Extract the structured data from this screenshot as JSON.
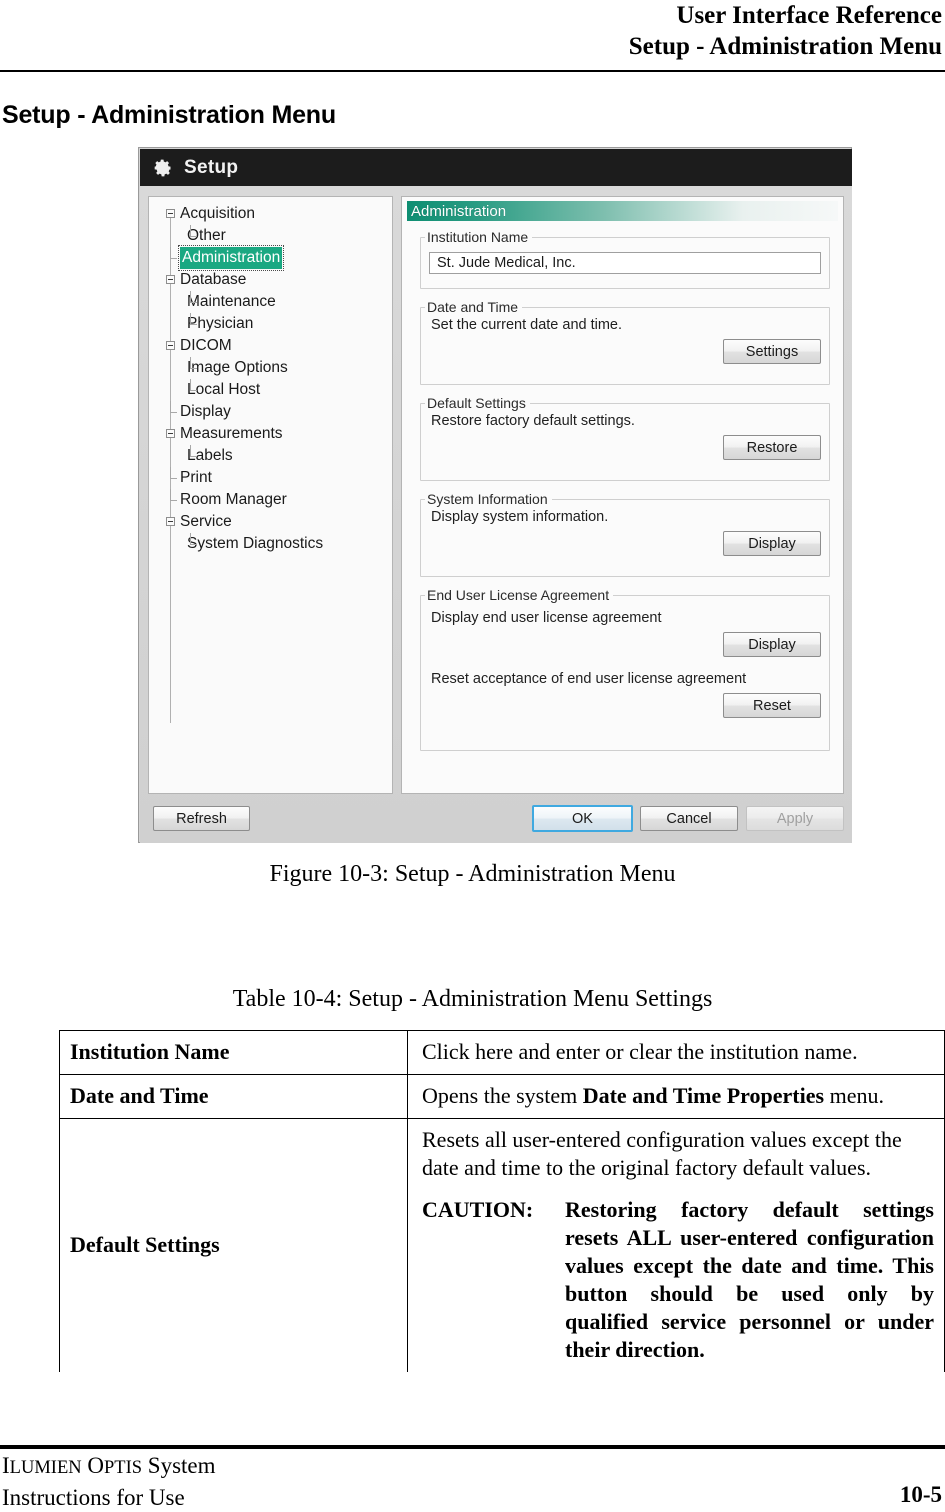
{
  "header": {
    "line1": "User Interface Reference",
    "line2": "Setup - Administration Menu"
  },
  "section_title": "Setup - Administration Menu",
  "figure": {
    "caption": "Figure 10-3:  Setup - Administration Menu",
    "dialog": {
      "title": "Setup",
      "icon": "gear-icon",
      "tree": {
        "items": [
          {
            "label": "Acquisition",
            "level": 0,
            "expander": true,
            "selected": false
          },
          {
            "label": "Other",
            "level": 1,
            "expander": false,
            "selected": false
          },
          {
            "label": "Administration",
            "level": 0,
            "expander": false,
            "selected": true
          },
          {
            "label": "Database",
            "level": 0,
            "expander": true,
            "selected": false
          },
          {
            "label": "Maintenance",
            "level": 1,
            "expander": false,
            "selected": false
          },
          {
            "label": "Physician",
            "level": 1,
            "expander": false,
            "selected": false
          },
          {
            "label": "DICOM",
            "level": 0,
            "expander": true,
            "selected": false
          },
          {
            "label": "Image Options",
            "level": 1,
            "expander": false,
            "selected": false
          },
          {
            "label": "Local Host",
            "level": 1,
            "expander": false,
            "selected": false
          },
          {
            "label": "Display",
            "level": 0,
            "expander": false,
            "selected": false
          },
          {
            "label": "Measurements",
            "level": 0,
            "expander": true,
            "selected": false
          },
          {
            "label": "Labels",
            "level": 1,
            "expander": false,
            "selected": false
          },
          {
            "label": "Print",
            "level": 0,
            "expander": false,
            "selected": false
          },
          {
            "label": "Room Manager",
            "level": 0,
            "expander": false,
            "selected": false
          },
          {
            "label": "Service",
            "level": 0,
            "expander": true,
            "selected": false
          },
          {
            "label": "System Diagnostics",
            "level": 1,
            "expander": false,
            "selected": false
          }
        ]
      },
      "panel": {
        "banner": "Administration",
        "groups": {
          "institution": {
            "legend": "Institution Name",
            "value": "St. Jude Medical, Inc.",
            "placeholder": ""
          },
          "datetime": {
            "legend": "Date and Time",
            "description": "Set the current date and time.",
            "button": "Settings"
          },
          "defaults": {
            "legend": "Default Settings",
            "description": "Restore factory default settings.",
            "button": "Restore"
          },
          "sysinfo": {
            "legend": "System Information",
            "description": "Display system information.",
            "button": "Display"
          },
          "eula": {
            "legend": "End User License Agreement",
            "description1": "Display end user license agreement",
            "button1": "Display",
            "description2": "Reset acceptance of end user license agreement",
            "button2": "Reset"
          }
        }
      },
      "buttons": {
        "refresh": "Refresh",
        "ok": "OK",
        "cancel": "Cancel",
        "apply": "Apply"
      },
      "colors": {
        "titlebar": "#1c1c1c",
        "selection": "#1aa882",
        "banner_accent": "#0e8e72",
        "focus_ring": "#3fa9e0"
      }
    }
  },
  "table": {
    "caption": "Table 10-4:  Setup - Administration Menu Settings",
    "rows": [
      {
        "term": "Institution Name",
        "desc": "Click here and enter or clear the institution name."
      },
      {
        "term": "Date and Time",
        "desc_pre": "Opens the system ",
        "desc_bold": "Date and Time Properties",
        "desc_post": " menu."
      },
      {
        "term": "Default Settings",
        "desc": "Resets all user-entered configuration values except the date and time to the original factory default values.",
        "caution_label": "CAUTION:",
        "caution_text": "Restoring factory default settings resets ALL user-entered configuration values except the date and time. This button should be used only by qualified service personnel or under their direction."
      }
    ]
  },
  "footer": {
    "product_lead": "I",
    "product_rest1": "LUMIEN",
    "product_lead2": " O",
    "product_rest2": "PTIS",
    "product_tail": " System",
    "doc_type": "Instructions for Use",
    "page_number": "10-5"
  }
}
